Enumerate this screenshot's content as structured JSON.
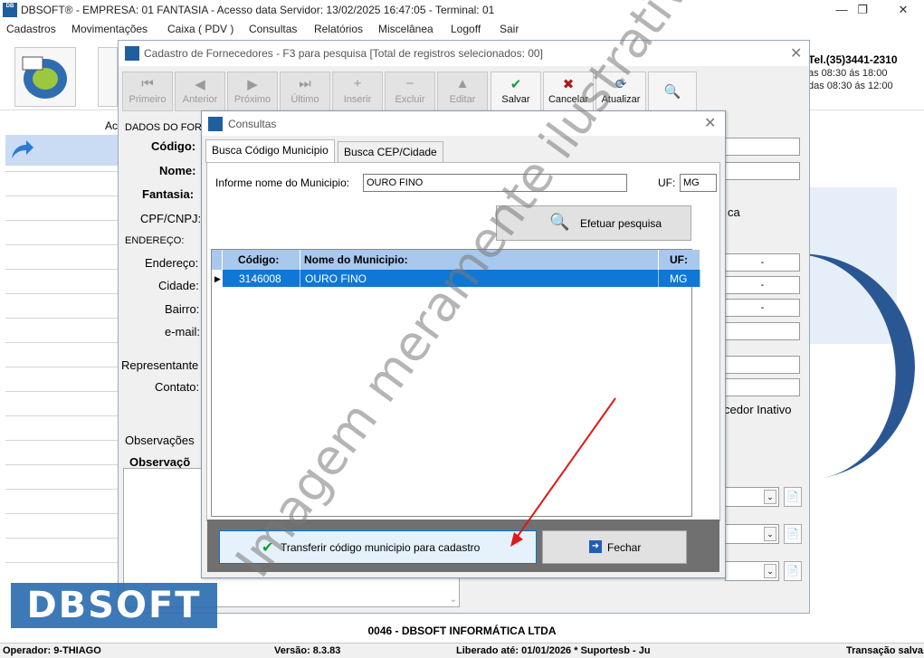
{
  "window": {
    "title": "DBSOFT® - EMPRESA: 01 FANTASIA - Acesso data Servidor: 13/02/2025 16:47:05 - Terminal: 01",
    "icon_text": "DB"
  },
  "menu": [
    "Cadastros",
    "Movimentações",
    "Caixa ( PDV )",
    "Consultas",
    "Relatórios",
    "Miscelânea",
    "Logoff",
    "Sair"
  ],
  "header": {
    "tel": "Tel.(35)3441-2310",
    "hours1": "as 08:30 ás 18:00",
    "hours2": "das 08:30 ás 12:00",
    "sidebar_prefix": "Ac"
  },
  "fornecedores": {
    "title": "Cadastro de Fornecedores - F3 para pesquisa [Total de registros selecionados: 00]",
    "toolbar": [
      {
        "label": "Primeiro",
        "icon": "⏮",
        "enabled": false
      },
      {
        "label": "Anterior",
        "icon": "◀",
        "enabled": false
      },
      {
        "label": "Próximo",
        "icon": "▶",
        "enabled": false
      },
      {
        "label": "Último",
        "icon": "⏭",
        "enabled": false
      },
      {
        "label": "Inserir",
        "icon": "+",
        "enabled": false
      },
      {
        "label": "Excluir",
        "icon": "−",
        "enabled": false
      },
      {
        "label": "Editar",
        "icon": "▲",
        "enabled": false
      },
      {
        "label": "Salvar",
        "icon": "✔",
        "enabled": true
      },
      {
        "label": "Cancelar",
        "icon": "✖",
        "enabled": true
      },
      {
        "label": "Atualizar",
        "icon": "⟳",
        "enabled": true
      }
    ],
    "section_dados": "DADOS DO FORN",
    "codigo_label": "Código:",
    "nome_label": "Nome:",
    "fantasia_label": "Fantasia:",
    "cpf_label": "CPF/CNPJ:",
    "section_endereco": "ENDEREÇO:",
    "endereco_label": "Endereço:",
    "cidade_label": "Cidade:",
    "bairro_label": "Bairro:",
    "email_label": "e-mail:",
    "representante_label": "Representante",
    "contato_label": "Contato:",
    "observacoes_tab": "Observações",
    "observacoes_label": "Observaçõ",
    "right_text_ca": "ca",
    "right_dash": "-",
    "inativo_label": "cedor Inativo"
  },
  "consultas": {
    "title": "Consultas",
    "tabs": [
      "Busca Código Municipio",
      "Busca CEP/Cidade"
    ],
    "municipio_label": "Informe nome do Municipio:",
    "municipio_value": "OURO FINO",
    "uf_label": "UF:",
    "uf_value": "MG",
    "search_button": "Efetuar pesquisa",
    "grid": {
      "headers": [
        "Código:",
        "Nome do Municipio:",
        "UF:"
      ],
      "rows": [
        {
          "codigo": "3146008",
          "nome": "OURO FINO",
          "uf": "MG"
        }
      ]
    },
    "transfer_button": "Transferir código municipio para cadastro",
    "close_button": "Fechar"
  },
  "watermark": "Imagem meramente ilustrativa",
  "logo_text": "DBSOFT",
  "company": "0046 - DBSOFT INFORMÁTICA LTDA",
  "status": {
    "operador": "Operador: 9-THIAGO",
    "versao": "Versão: 8.3.83",
    "liberado": "Liberado até: 01/01/2026 * Suportesb - Ju",
    "transacao": "Transação salva."
  },
  "colors": {
    "selection": "#0f78d7",
    "grid_header": "#a9c8ee",
    "accent": "#1f5f9e"
  }
}
